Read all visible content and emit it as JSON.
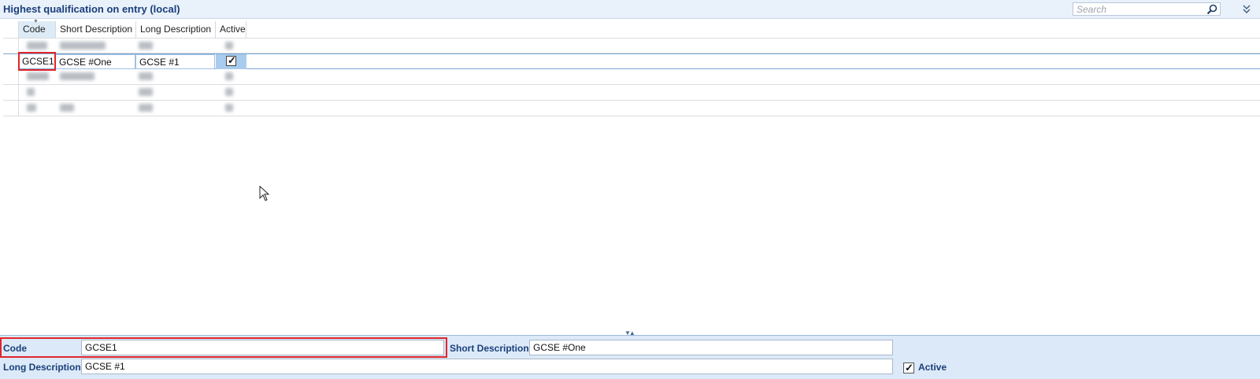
{
  "window": {
    "title": "Highest qualification on entry (local)",
    "search_placeholder": "Search"
  },
  "grid": {
    "columns": [
      "Code",
      "Short Description",
      "Long Description",
      "Active"
    ],
    "sorted_column": "Code",
    "selected_row": {
      "code": "GCSE1",
      "short_description": "GCSE #One",
      "long_description": "GCSE #1",
      "active": true
    },
    "blurred_rows": [
      {
        "code": "FSMQ",
        "short_description": "qualification",
        "long_description": "text",
        "active": true
      },
      {
        "code": "CODE",
        "short_description": "content",
        "long_description": "text",
        "active": true
      },
      {
        "code": "X",
        "short_description": "",
        "long_description": "text",
        "active": true
      },
      {
        "code": "Y",
        "short_description": "text",
        "long_description": "text",
        "active": true
      }
    ]
  },
  "detail_panel": {
    "code_label": "Code",
    "code_value": "GCSE1",
    "short_description_label": "Short Description",
    "short_description_value": "GCSE #One",
    "long_description_label": "Long Description",
    "long_description_value": "GCSE #1",
    "active_label": "Active",
    "active_checked": true
  },
  "colors": {
    "title_text": "#1a3f7a",
    "highlight_border": "#e0262b",
    "panel_background": "#dce9f8",
    "selected_cell": "#a9cbed"
  }
}
